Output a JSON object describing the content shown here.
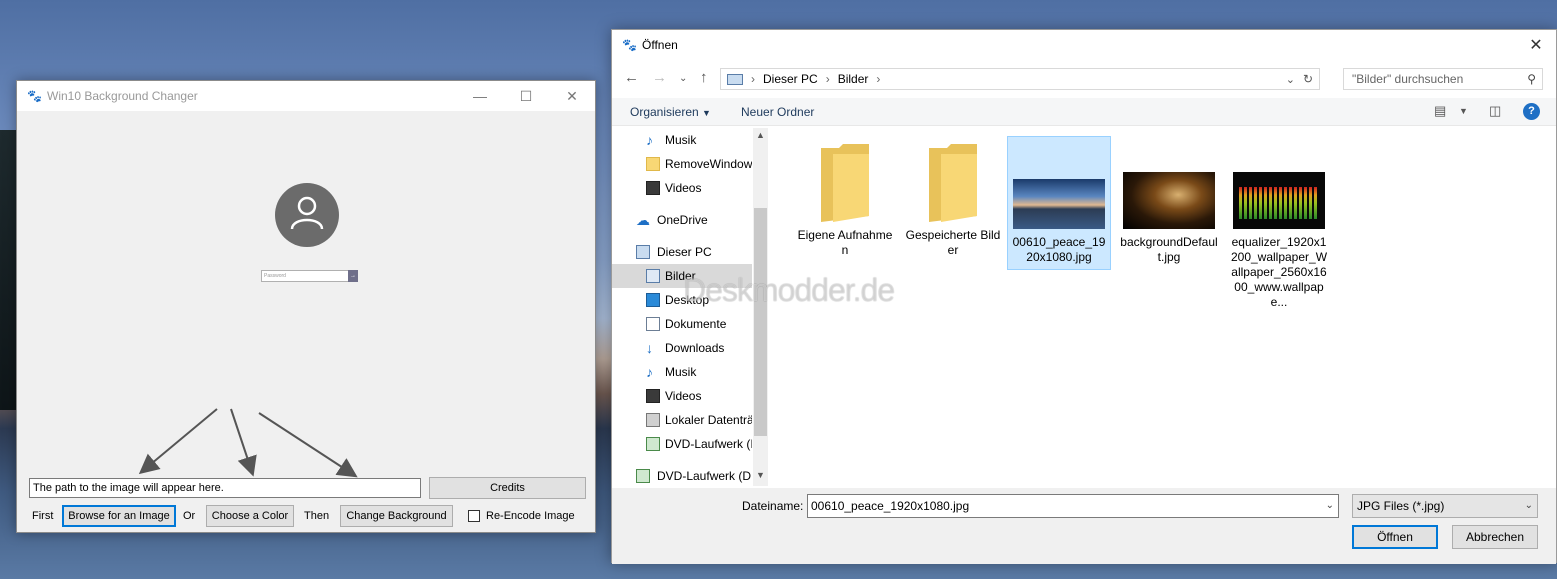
{
  "app": {
    "title": "Win10 Background Changer",
    "password_placeholder": "Password",
    "path_text": "The path to the image will appear here.",
    "credits_label": "Credits",
    "first_label": "First",
    "browse_label": "Browse for an Image",
    "or_label": "Or",
    "choose_color_label": "Choose a Color",
    "then_label": "Then",
    "change_bg_label": "Change Background",
    "reencode_label": "Re-Encode Image"
  },
  "dialog": {
    "title": "Öffnen",
    "breadcrumb": [
      "Dieser PC",
      "Bilder"
    ],
    "search_placeholder": "\"Bilder\" durchsuchen",
    "organize_label": "Organisieren",
    "new_folder_label": "Neuer Ordner",
    "tree": [
      {
        "label": "Musik",
        "icon": "music-icon",
        "selected": false
      },
      {
        "label": "RemoveWindow",
        "icon": "folder-icon",
        "selected": false
      },
      {
        "label": "Videos",
        "icon": "video-icon",
        "selected": false
      },
      {
        "label": "OneDrive",
        "icon": "cloud-icon",
        "selected": false
      },
      {
        "label": "Dieser PC",
        "icon": "computer-icon",
        "selected": false
      },
      {
        "label": "Bilder",
        "icon": "pictures-icon",
        "selected": true
      },
      {
        "label": "Desktop",
        "icon": "desktop-icon",
        "selected": false
      },
      {
        "label": "Dokumente",
        "icon": "documents-icon",
        "selected": false
      },
      {
        "label": "Downloads",
        "icon": "download-icon",
        "selected": false
      },
      {
        "label": "Musik",
        "icon": "music-icon",
        "selected": false
      },
      {
        "label": "Videos",
        "icon": "video-icon",
        "selected": false
      },
      {
        "label": "Lokaler Datenträ",
        "icon": "drive-icon",
        "selected": false
      },
      {
        "label": "DVD-Laufwerk (I",
        "icon": "dvd-icon",
        "selected": false
      },
      {
        "label": "DVD-Laufwerk (D:",
        "icon": "dvd-icon",
        "selected": false
      }
    ],
    "files": [
      {
        "name": "Eigene Aufnahmen",
        "kind": "folder"
      },
      {
        "name": "Gespeicherte Bilder",
        "kind": "folder"
      },
      {
        "name": "00610_peace_1920x1080.jpg",
        "kind": "image-lake",
        "selected": true
      },
      {
        "name": "backgroundDefault.jpg",
        "kind": "image-gold"
      },
      {
        "name": "equalizer_1920x1200_wallpaper_Wallpaper_2560x1600_www.wallpape...",
        "kind": "image-eq"
      }
    ],
    "filename_label": "Dateiname:",
    "filename_value": "00610_peace_1920x1080.jpg",
    "filetype_value": "JPG Files (*.jpg)",
    "open_label": "Öffnen",
    "cancel_label": "Abbrechen"
  },
  "watermark": "Deskmodder.de"
}
